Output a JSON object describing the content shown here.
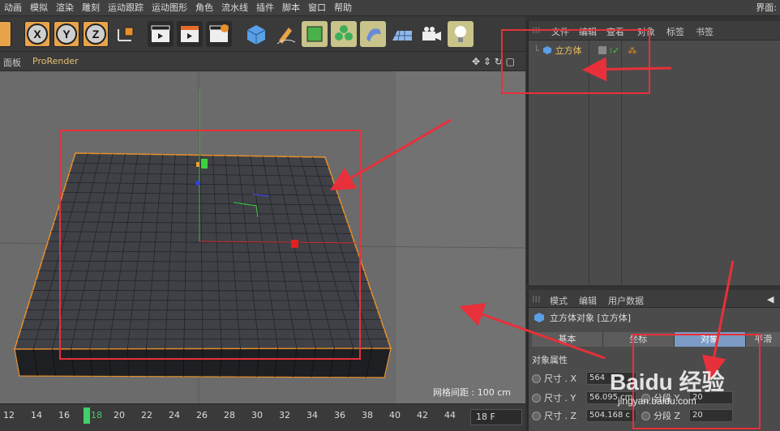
{
  "menu": [
    "动画",
    "模拟",
    "渲染",
    "雕刻",
    "运动跟踪",
    "运动图形",
    "角色",
    "流水线",
    "插件",
    "脚本",
    "窗口",
    "帮助"
  ],
  "menu_right": "界面:",
  "toolbar": {
    "x_label": "X",
    "y_label": "Y",
    "z_label": "Z"
  },
  "viewport": {
    "tab_panel": "面板",
    "tab_prorender": "ProRender",
    "grid_spacing": "网格间距 : 100 cm"
  },
  "timeline": {
    "ticks": [
      "12",
      "14",
      "16",
      "18",
      "20",
      "22",
      "24",
      "26",
      "28",
      "30",
      "32",
      "34",
      "36",
      "38",
      "40",
      "42",
      "44"
    ],
    "current": "18",
    "frame_field": "18 F"
  },
  "object_manager": {
    "menu": [
      "文件",
      "编辑",
      "查看",
      "对象",
      "标签",
      "书签"
    ],
    "object_name": "立方体"
  },
  "attributes": {
    "menu": [
      "模式",
      "编辑",
      "用户数据"
    ],
    "title": "立方体对象 [立方体]",
    "tabs": [
      "基本",
      "坐标",
      "对象",
      "平滑"
    ],
    "section": "对象属性",
    "size_x_label": "尺寸 . X",
    "size_x": "564",
    "size_y_label": "尺寸 . Y",
    "size_y": "56.095 cm",
    "size_z_label": "尺寸 . Z",
    "size_z": "504.168 c",
    "seg_y_label": "分段 Y",
    "seg_y": "20",
    "seg_z_label": "分段 Z",
    "seg_z": "20"
  },
  "watermark": {
    "brand": "Baidu 经验",
    "url": "jingyan.baidu.com"
  },
  "colors": {
    "annotation": "#e8303a",
    "cube_edge": "#e8902a",
    "active_tab": "#7c9cc6"
  }
}
